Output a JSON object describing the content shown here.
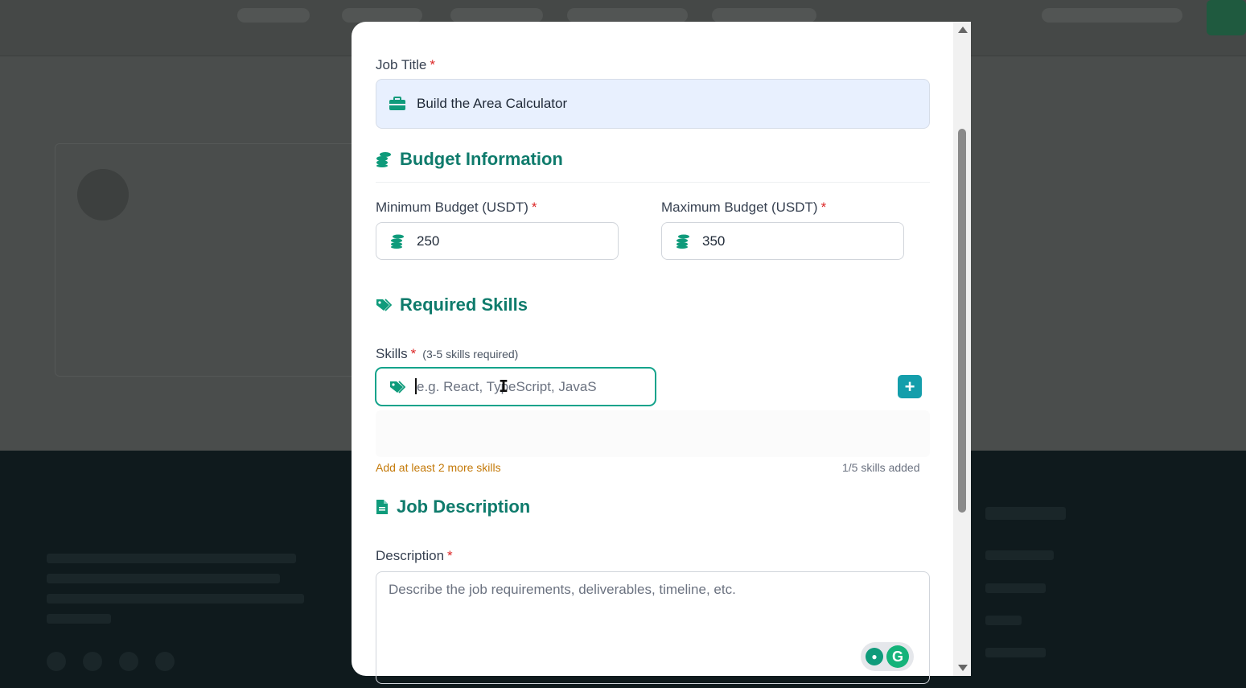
{
  "modal": {
    "job_title_label": "Job Title",
    "job_title_value": "Build the Area Calculator",
    "budget_section": "Budget Information",
    "min_budget_label": "Minimum Budget (USDT)",
    "min_budget_value": "250",
    "max_budget_label": "Maximum Budget (USDT)",
    "max_budget_value": "350",
    "skills_section": "Required Skills",
    "skills_label": "Skills",
    "skills_hint": "(3-5 skills required)",
    "skills_placeholder": "e.g. React, TypeScript, JavaS",
    "skills_warning": "Add at least 2 more skills",
    "skills_count": "1/5 skills added",
    "description_section": "Job Description",
    "description_label": "Description",
    "description_placeholder": "Describe the job requirements, deliverables, timeline, etc.",
    "required_mark": "*"
  },
  "colors": {
    "accent": "#0f7b6c",
    "add_button": "#149eab",
    "warning": "#c47a0a",
    "required": "#dc2626"
  },
  "icons": {
    "job_title": "briefcase-icon",
    "budget": "coins-icon",
    "skills": "tags-icon",
    "description": "document-icon",
    "add": "plus-icon"
  }
}
